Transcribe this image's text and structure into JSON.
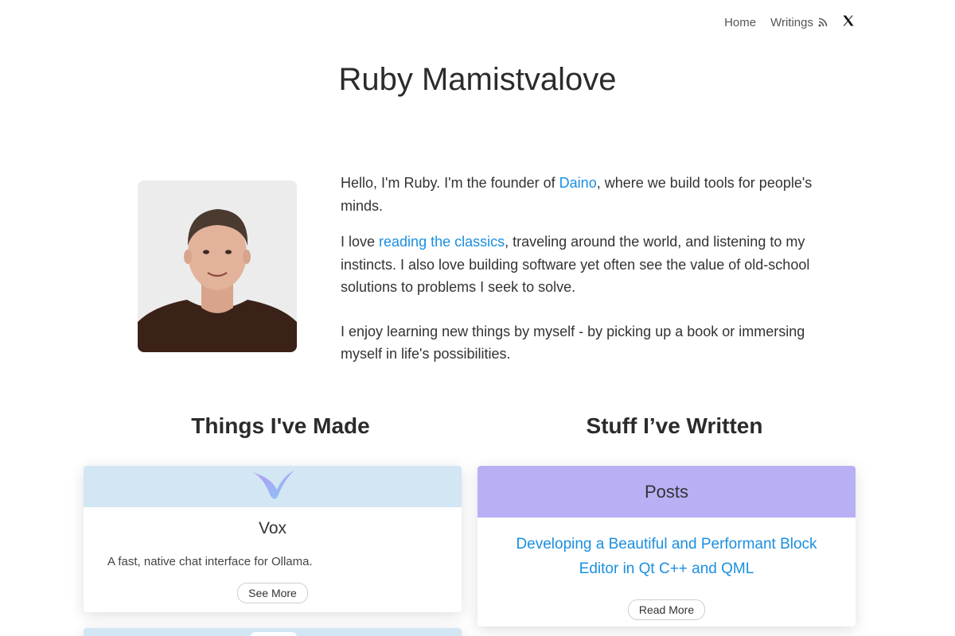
{
  "nav": {
    "home_label": "Home",
    "writings_label": "Writings",
    "rss_icon": "rss-icon",
    "x_icon": "x-logo-icon"
  },
  "header": {
    "title": "Ruby Mamistvalove"
  },
  "bio": {
    "p1_before": "Hello, I'm Ruby. I'm the founder of ",
    "p1_link": "Daino",
    "p1_after": ", where we build tools for people's minds.",
    "p2_before": "I love ",
    "p2_link": "reading the classics",
    "p2_after": ", traveling around the world, and listening to my instincts. I also love building software yet often see the value of old-school solutions to problems I seek to solve.",
    "p3": "I enjoy learning new things by myself - by picking up a book or immersing myself in life's possibilities."
  },
  "sections": {
    "made_title": "Things I've Made",
    "written_title": "Stuff I’ve Written"
  },
  "projects": [
    {
      "name": "Vox",
      "description": "A fast, native chat interface for Ollama.",
      "button_label": "See More"
    }
  ],
  "writing": {
    "band_label": "Posts",
    "post_title": "Developing a Beautiful and Performant Block Editor in Qt C++ and QML",
    "button_label": "Read More"
  },
  "colors": {
    "link": "#1a8fe0",
    "projects_band": "#d2e6f4",
    "posts_band": "#b7b0f4"
  }
}
